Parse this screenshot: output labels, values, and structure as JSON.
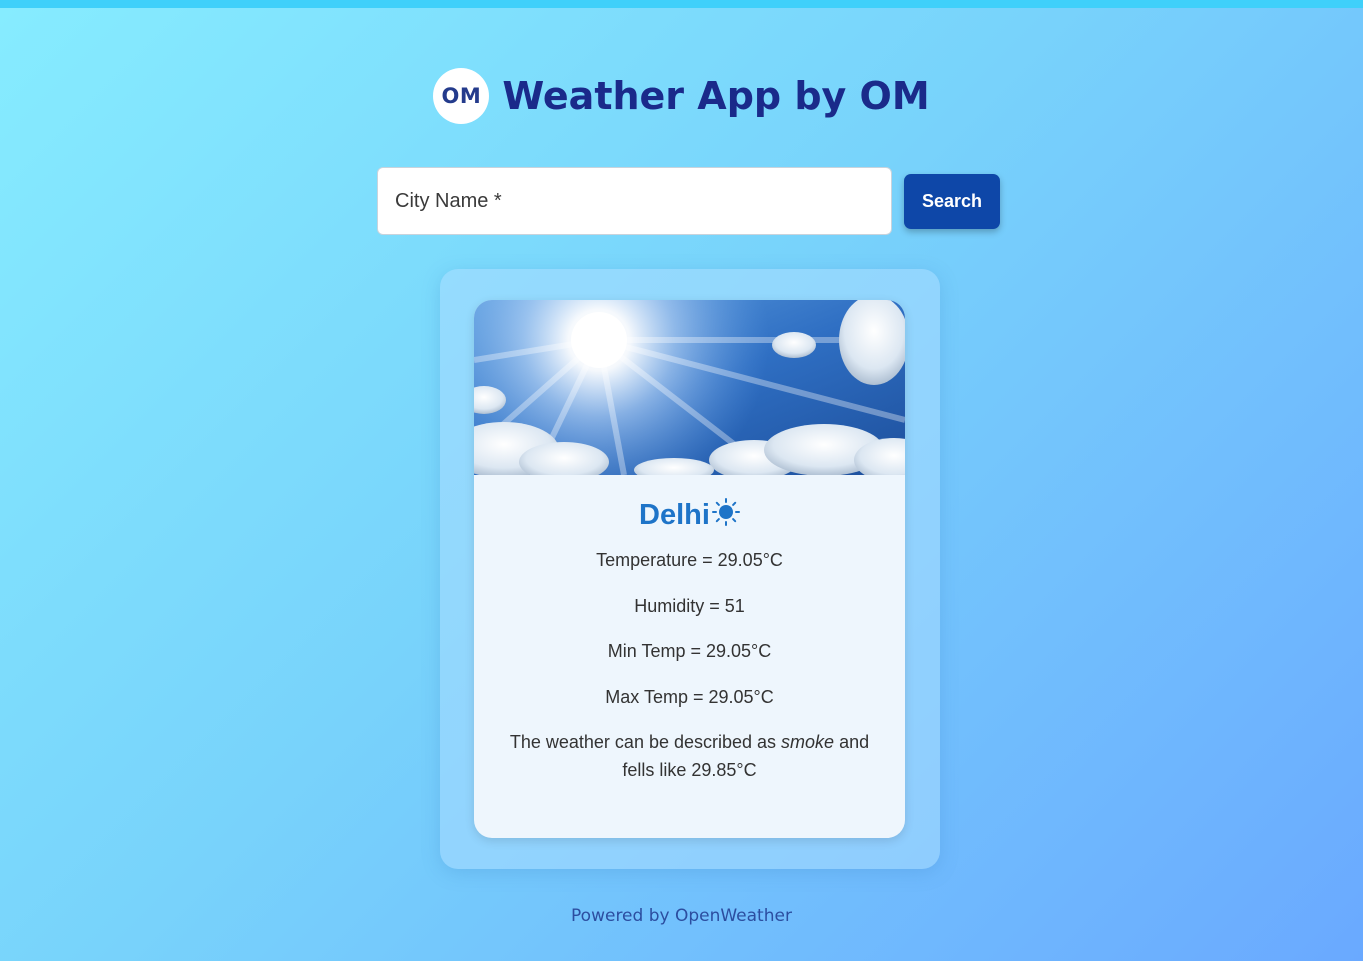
{
  "header": {
    "logo_text": "OM",
    "title": "Weather App by OM"
  },
  "search": {
    "placeholder": "City Name *",
    "button_label": "Search"
  },
  "weather": {
    "image_icon": "sunny-sky-image",
    "city": "Delhi",
    "condition_icon": "sun-icon",
    "temperature": "Temperature = 29.05°C",
    "humidity": "Humidity = 51",
    "min_temp": "Min Temp = 29.05°C",
    "max_temp": "Max Temp = 29.05°C",
    "description_prefix": "The weather can be described as ",
    "description_condition": "smoke",
    "description_suffix": " and fells like 29.85°C"
  },
  "footer": {
    "text": "Powered by OpenWeather"
  },
  "colors": {
    "title": "#1a2a8a",
    "button": "#0e47a8",
    "city": "#1e74c8"
  }
}
